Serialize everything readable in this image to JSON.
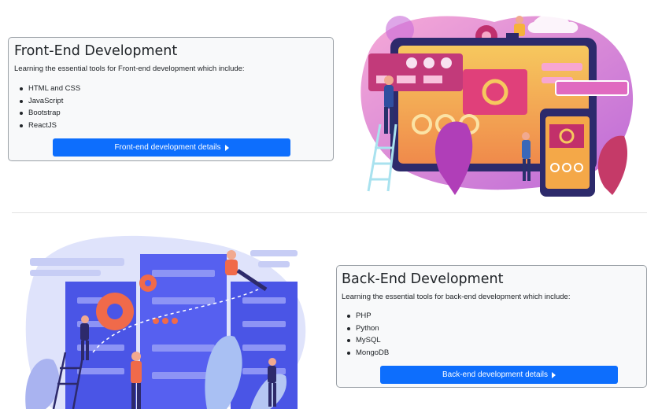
{
  "frontend": {
    "title": "Front-End Development",
    "intro": "Learning the essential tools for Front-end development which include:",
    "items": [
      "HTML and CSS",
      "JavaScript",
      "Bootstrap",
      "ReactJS"
    ],
    "button_label": "Front-end development details"
  },
  "backend": {
    "title": "Back-End Development",
    "intro": "Learning the essential tools for back-end development which include:",
    "items": [
      "PHP",
      "Python",
      "MySQL",
      "MongoDB"
    ],
    "button_label": "Back-end development details"
  },
  "colors": {
    "primary": "#0d6efd",
    "card_bg": "#f8f9fa",
    "frontend_illustration": "#c86bd8",
    "backend_illustration": "#4f5bea"
  },
  "icons": {
    "button_arrow": "caret-right-icon"
  }
}
